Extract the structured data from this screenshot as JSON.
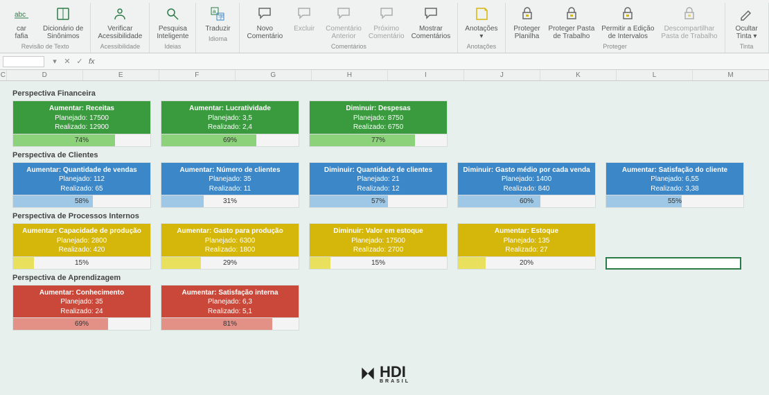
{
  "ribbon": {
    "groups": [
      {
        "label": "Revisão de Texto",
        "buttons": [
          {
            "name": "spellcheck-button",
            "label": "car\nfafia",
            "icon": "abc"
          },
          {
            "name": "thesaurus-button",
            "label": "Dicionário de\nSinônimos",
            "icon": "book"
          }
        ]
      },
      {
        "label": "Acessibilidade",
        "buttons": [
          {
            "name": "accessibility-button",
            "label": "Verificar\nAcessibilidade",
            "icon": "person"
          }
        ]
      },
      {
        "label": "Ideias",
        "buttons": [
          {
            "name": "smart-lookup-button",
            "label": "Pesquisa\nInteligente",
            "icon": "search"
          }
        ]
      },
      {
        "label": "Idioma",
        "buttons": [
          {
            "name": "translate-button",
            "label": "Traduzir",
            "icon": "translate"
          }
        ]
      },
      {
        "label": "Comentários",
        "buttons": [
          {
            "name": "new-comment-button",
            "label": "Novo\nComentário",
            "icon": "comment"
          },
          {
            "name": "delete-comment-button",
            "label": "Excluir",
            "icon": "comment",
            "disabled": true
          },
          {
            "name": "prev-comment-button",
            "label": "Comentário\nAnterior",
            "icon": "comment",
            "disabled": true
          },
          {
            "name": "next-comment-button",
            "label": "Próximo\nComentário",
            "icon": "comment",
            "disabled": true
          },
          {
            "name": "show-comments-button",
            "label": "Mostrar\nComentários",
            "icon": "comment"
          }
        ]
      },
      {
        "label": "Anotações",
        "buttons": [
          {
            "name": "notes-button",
            "label": "Anotações\n▾",
            "icon": "note"
          }
        ]
      },
      {
        "label": "Proteger",
        "buttons": [
          {
            "name": "protect-sheet-button",
            "label": "Proteger\nPlanilha",
            "icon": "lock"
          },
          {
            "name": "protect-workbook-button",
            "label": "Proteger Pasta\nde Trabalho",
            "icon": "lock"
          },
          {
            "name": "allow-edit-ranges-button",
            "label": "Permitir a Edição\nde Intervalos",
            "icon": "lock"
          },
          {
            "name": "unshare-button",
            "label": "Descompartilhar\nPasta de Trabalho",
            "icon": "lock",
            "disabled": true
          }
        ]
      },
      {
        "label": "Tinta",
        "buttons": [
          {
            "name": "hide-ink-button",
            "label": "Ocultar\nTinta ▾",
            "icon": "pen"
          }
        ]
      }
    ]
  },
  "formula_bar": {
    "cell_ref": "",
    "cancel": "✕",
    "enter": "✓",
    "fx": "fx"
  },
  "columns": [
    "C",
    "D",
    "E",
    "F",
    "G",
    "H",
    "I",
    "J",
    "K",
    "L",
    "M"
  ],
  "sections": [
    {
      "title": "Perspectiva Financeira",
      "color": "green",
      "cards": [
        {
          "title": "Aumentar: Receitas",
          "line1": "Planejado: 17500",
          "line2": "Realizado: 12900",
          "pct": 74
        },
        {
          "title": "Aumentar: Lucratividade",
          "line1": "Planejado: 3,5",
          "line2": "Realizado: 2,4",
          "pct": 69
        },
        {
          "title": "Diminuir: Despesas",
          "line1": "Planejado: 8750",
          "line2": "Realizado: 6750",
          "pct": 77
        }
      ]
    },
    {
      "title": "Perspectiva de Clientes",
      "color": "blue",
      "cards": [
        {
          "title": "Aumentar: Quantidade de vendas",
          "line1": "Planejado: 112",
          "line2": "Realizado: 65",
          "pct": 58
        },
        {
          "title": "Aumentar: Número de clientes",
          "line1": "Planejado: 35",
          "line2": "Realizado: 11",
          "pct": 31
        },
        {
          "title": "Diminuir: Quantidade de clientes",
          "line1": "Planejado: 21",
          "line2": "Realizado: 12",
          "pct": 57
        },
        {
          "title": "Diminuir: Gasto médio por cada venda",
          "line1": "Planejado: 1400",
          "line2": "Realizado: 840",
          "pct": 60
        },
        {
          "title": "Aumentar: Satisfação do cliente",
          "line1": "Planejado: 6,55",
          "line2": "Realizado: 3,38",
          "pct": 55
        }
      ]
    },
    {
      "title": "Perspectiva de Processos Internos",
      "color": "yellow",
      "cards": [
        {
          "title": "Aumentar: Capacidade de produção",
          "line1": "Planejado: 2800",
          "line2": "Realizado: 420",
          "pct": 15
        },
        {
          "title": "Aumentar: Gasto para produção",
          "line1": "Planejado: 6300",
          "line2": "Realizado: 1800",
          "pct": 29
        },
        {
          "title": "Diminuir: Valor em estoque",
          "line1": "Planejado: 17500",
          "line2": "Realizado: 2700",
          "pct": 15
        },
        {
          "title": "Aumentar: Estoque",
          "line1": "Planejado: 135",
          "line2": "Realizado: 27",
          "pct": 20
        }
      ],
      "hasSelection": true
    },
    {
      "title": "Perspectiva de Aprendizagem",
      "color": "red",
      "cards": [
        {
          "title": "Aumentar: Conhecimento",
          "line1": "Planejado: 35",
          "line2": "Realizado: 24",
          "pct": 69
        },
        {
          "title": "Aumentar: Satisfação interna",
          "line1": "Planejado: 6,3",
          "line2": "Realizado: 5,1",
          "pct": 81
        }
      ]
    }
  ],
  "logo": {
    "text": "HDI",
    "sub": "BRASIL"
  }
}
